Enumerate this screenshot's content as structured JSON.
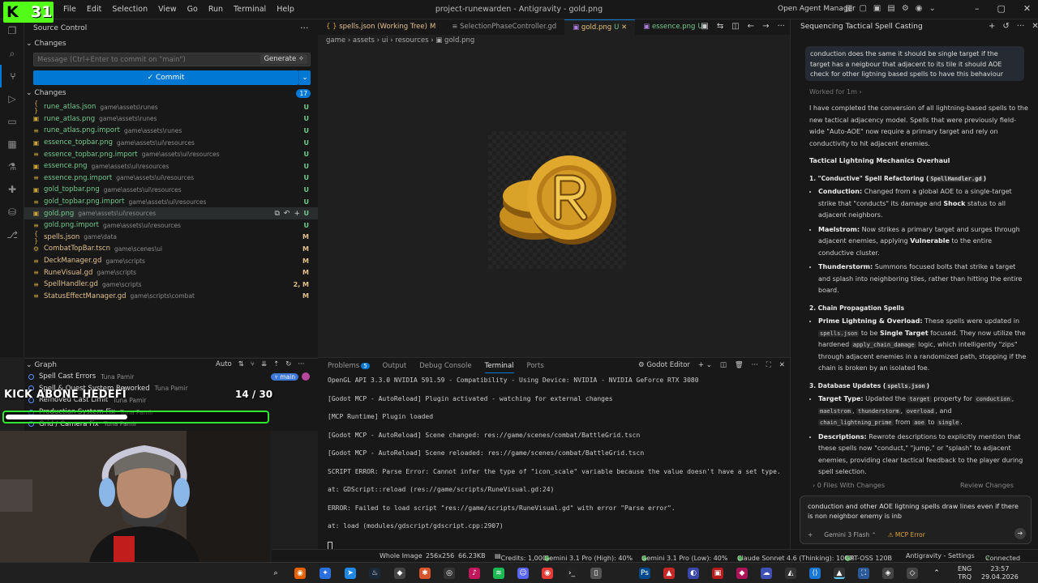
{
  "window": {
    "title": "project-runewarden - Antigravity - gold.png",
    "menu": [
      "File",
      "Edit",
      "Selection",
      "View",
      "Go",
      "Run",
      "Terminal",
      "Help"
    ],
    "open_agent_manager": "Open Agent Manager"
  },
  "source_control": {
    "title": "Source Control",
    "changes_header": "Changes",
    "message_placeholder": "Message (Ctrl+Enter to commit on \"main\")",
    "generate_label": "Generate",
    "commit_label": "✓ Commit",
    "changes_label": "Changes",
    "changes_count": "17",
    "files": [
      {
        "icon": "{ }",
        "name": "rune_atlas.json",
        "path": "game\\assets\\runes",
        "status": "U"
      },
      {
        "icon": "▣",
        "name": "rune_atlas.png",
        "path": "game\\assets\\runes",
        "status": "U"
      },
      {
        "icon": "≡",
        "name": "rune_atlas.png.import",
        "path": "game\\assets\\runes",
        "status": "U"
      },
      {
        "icon": "▣",
        "name": "essence_topbar.png",
        "path": "game\\assets\\ui\\resources",
        "status": "U"
      },
      {
        "icon": "≡",
        "name": "essence_topbar.png.import",
        "path": "game\\assets\\ui\\resources",
        "status": "U"
      },
      {
        "icon": "▣",
        "name": "essence.png",
        "path": "game\\assets\\ui\\resources",
        "status": "U"
      },
      {
        "icon": "≡",
        "name": "essence.png.import",
        "path": "game\\assets\\ui\\resources",
        "status": "U"
      },
      {
        "icon": "▣",
        "name": "gold_topbar.png",
        "path": "game\\assets\\ui\\resources",
        "status": "U"
      },
      {
        "icon": "≡",
        "name": "gold_topbar.png.import",
        "path": "game\\assets\\ui\\resources",
        "status": "U"
      },
      {
        "icon": "▣",
        "name": "gold.png",
        "path": "game\\assets\\ui\\resources",
        "status": "U"
      },
      {
        "icon": "≡",
        "name": "gold.png.import",
        "path": "game\\assets\\ui\\resources",
        "status": "U"
      },
      {
        "icon": "{ }",
        "name": "spells.json",
        "path": "game\\data",
        "status": "M"
      },
      {
        "icon": "⚙",
        "name": "CombatTopBar.tscn",
        "path": "game\\scenes\\ui",
        "status": "M"
      },
      {
        "icon": "≡",
        "name": "DeckManager.gd",
        "path": "game\\scripts",
        "status": "M"
      },
      {
        "icon": "≡",
        "name": "RuneVisual.gd",
        "path": "game\\scripts",
        "status": "M"
      },
      {
        "icon": "≡",
        "name": "SpellHandler.gd",
        "path": "game\\scripts",
        "status": "2, M"
      },
      {
        "icon": "≡",
        "name": "StatusEffectManager.gd",
        "path": "game\\scripts\\combat",
        "status": "M"
      }
    ]
  },
  "graph": {
    "title": "Graph",
    "auto_label": "Auto",
    "commits": [
      {
        "msg": "Spell Cast Errors",
        "author": "Tuna Pamir",
        "branch": "main"
      },
      {
        "msg": "Spell & Quest System Reworked",
        "author": "Tuna Pamir",
        "branch": ""
      },
      {
        "msg": "Removed Cast Limit",
        "author": "Tuna Pamir",
        "branch": ""
      },
      {
        "msg": "Production System Fix",
        "author": "Tuna Pamir",
        "branch": ""
      },
      {
        "msg": "Grid / Camera Fix",
        "author": "Tuna Pamir",
        "branch": ""
      }
    ]
  },
  "overlay": {
    "kick_text": "KICK ABONE HEDEFİ",
    "kick_count": "14 / 30",
    "progress": 0.4667,
    "logo_text": "31",
    "accent": "#53fc18"
  },
  "editor": {
    "tabs": [
      {
        "label": "spells.json (Working Tree)",
        "flag": "M"
      },
      {
        "label": "SelectionPhaseController.gd",
        "flag": ""
      },
      {
        "label": "gold.png",
        "flag": "U"
      },
      {
        "label": "essence.png",
        "flag": "U"
      }
    ],
    "breadcrumbs": "game › assets › ui › resources › ▣ gold.png"
  },
  "panel": {
    "tabs": [
      "Problems",
      "Output",
      "Debug Console",
      "Terminal",
      "Ports"
    ],
    "problems_count": "5",
    "godot_editor": "Godot Editor",
    "terminal_lines": [
      "OpenGL API 3.3.0 NVIDIA 591.59 - Compatibility - Using Device: NVIDIA - NVIDIA GeForce RTX 3080",
      "[Godot MCP - AutoReload] Plugin activated - watching for external changes",
      "[MCP Runtime] Plugin loaded",
      "[Godot MCP - AutoReload] Scene changed: res://game/scenes/combat/BattleGrid.tscn",
      "[Godot MCP - AutoReload] Scene reloaded: res://game/scenes/combat/BattleGrid.tscn",
      "SCRIPT ERROR: Parse Error: Cannot infer the type of \"icon_scale\" variable because the value doesn't have a set type.",
      "   at: GDScript::reload (res://game/scripts/RuneVisual.gd:24)",
      "ERROR: Failed to load script \"res://game/scripts/RuneVisual.gd\" with error \"Parse error\".",
      "   at: load (modules/gdscript/gdscript.cpp:2907)"
    ]
  },
  "chat": {
    "title": "Sequencing Tactical Spell Casting",
    "user_message": "conduction does the same it should be single target if the target has a neigbour that adjacent to its tile it should AOE check for other ligtning based spells to have this behaviour",
    "worked_for": "Worked for 1m",
    "intro": "I have completed the conversion of all lightning-based spells to the new tactical adjacency model. Spells that were previously field-wide \"Auto-AOE\" now require a primary target and rely on conductivity to hit adjacent enemies.",
    "heading": "Tactical Lightning Mechanics Overhaul",
    "s1_title": "1. \"Conductive\" Spell Refactoring (",
    "s1_code": "SpellHandler.gd",
    "s1_close": ")",
    "b_conduction": "Conduction:",
    "t_conduction_1": " Changed from a global AOE to a single-target strike that \"conducts\" its damage and ",
    "t_shock": "Shock",
    "t_conduction_2": " status to all adjacent neighbors.",
    "b_maelstrom": "Maelstrom:",
    "t_maelstrom_1": " Now strikes a primary target and surges through adjacent enemies, applying ",
    "t_vulnerable": "Vulnerable",
    "t_maelstrom_2": " to the entire conductive cluster.",
    "b_thunderstorm": "Thunderstorm:",
    "t_thunderstorm": " Summons focused bolts that strike a target and splash into neighboring tiles, rather than hitting the entire board.",
    "s2_title": "2. Chain Propagation Spells",
    "b_prime": "Prime Lightning & Overload:",
    "t_prime_1": " These spells were updated in ",
    "c_spells": "spells.json",
    "t_prime_2": " to be ",
    "t_single": "Single Target",
    "t_prime_3": " focused. They now utilize the hardened ",
    "c_chain": "apply_chain_damage",
    "t_prime_4": " logic, which intelligently \"zips\" through adjacent enemies in a randomized path, stopping if the chain is broken by an isolated foe.",
    "s3_title": "3. Database Updates (",
    "s3_code": "spells.json",
    "s3_close": ")",
    "b_target": "Target Type:",
    "t_target_1": " Updated the ",
    "c_target": "target",
    "t_target_2": " property for ",
    "c_conduction": "conduction",
    "c_maelstrom": "maelstrom",
    "c_thunderstorm": "thunderstorm",
    "c_overload": "overload",
    "t_and": ", and",
    "c_chainprime": "chain_lightning_prime",
    "t_from": " from ",
    "c_aoe": "aoe",
    "t_to": " to ",
    "c_singlev": "single",
    "b_desc": "Descriptions:",
    "t_desc": " Rewrote descriptions to explicitly mention that these spells now \"conduct,\" \"jump,\" or \"splash\" to adjacent enemies, providing clear tactical feedback to the player during spell selection.",
    "files_changes": "0 Files With Changes",
    "review_changes": "Review Changes",
    "input_text": "conduction and other AOE ligtning spells draw lines even if there is non neighbor enemy is inb",
    "model": "Gemini 3 Flash",
    "mcp_error": "⚠ MCP Error"
  },
  "status": {
    "whole_image": "Whole Image",
    "dims": "256x256",
    "size": "66.23KB",
    "credits": "Credits: 1,000",
    "g_high": "Gemini 3.1 Pro (High): 40%",
    "g_low": "Gemini 3.1 Pro (Low): 40%",
    "claude": "Claude Sonnet 4.6 (Thinking): 100%",
    "gpt": "GPT-OSS 120B",
    "settings": "Antigravity - Settings",
    "connected": "Connected"
  },
  "taskbar": {
    "lang1": "ENG",
    "lang2": "TRQ",
    "time": "23:57",
    "date": "29.04.2026"
  }
}
